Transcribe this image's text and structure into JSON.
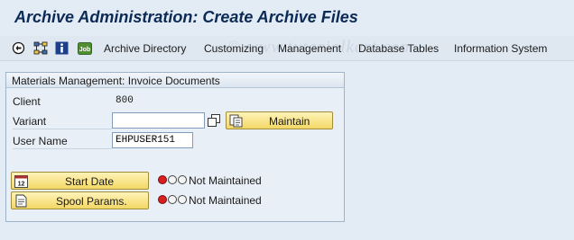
{
  "title": "Archive Administration: Create Archive Files",
  "watermark": "© www.tutorialkart.com",
  "toolbar": {
    "icons": [
      "execute-icon",
      "network-icon",
      "info-icon",
      "job-log-icon"
    ],
    "menu": [
      "Archive Directory",
      "Customizing",
      "Management",
      "Database Tables",
      "Information System"
    ]
  },
  "group": {
    "title": "Materials Management: Invoice Documents",
    "client_label": "Client",
    "client_value": "800",
    "variant_label": "Variant",
    "variant_value": "",
    "maintain_label": "Maintain",
    "user_label": "User Name",
    "user_value": "EHPUSER151",
    "start_date_label": "Start Date",
    "start_date_status": "Not Maintained",
    "spool_label": "Spool Params.",
    "spool_status": "Not Maintained"
  },
  "colors": {
    "title": "#0b2a55",
    "button": "#f3d866",
    "status_red": "#d62020"
  }
}
